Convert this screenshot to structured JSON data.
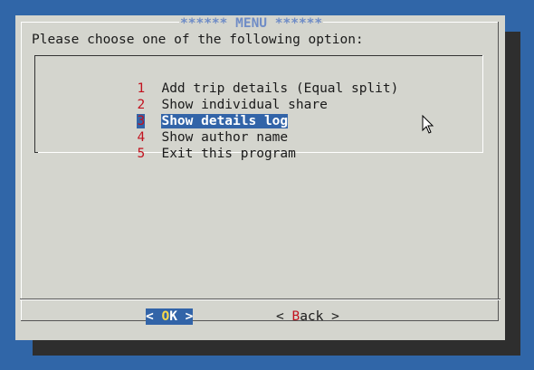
{
  "dialog": {
    "title": "****** MENU ******",
    "prompt": "Please choose one of the following option:"
  },
  "menu": {
    "items": [
      {
        "num": "1",
        "label": "Add trip details (Equal split)"
      },
      {
        "num": "2",
        "label": "Show individual share"
      },
      {
        "num": "3",
        "label": "Show details log",
        "selected": true
      },
      {
        "num": "4",
        "label": "Show author name"
      },
      {
        "num": "5",
        "label": "Exit this program"
      }
    ]
  },
  "buttons": {
    "ok": {
      "left": "< ",
      "hot": "O",
      "pre": "",
      "post": "K",
      "right": " >"
    },
    "back": {
      "left": "< ",
      "hot": "B",
      "post": "ack",
      "right": " >"
    }
  },
  "colors": {
    "desktop": "#3066a8",
    "dialog": "#d4d5ce",
    "highlight": "#3264a8",
    "hotkey": "#c2121e",
    "title": "#6f8cc6"
  },
  "icons": {
    "cursor": "mouse-pointer-icon"
  }
}
